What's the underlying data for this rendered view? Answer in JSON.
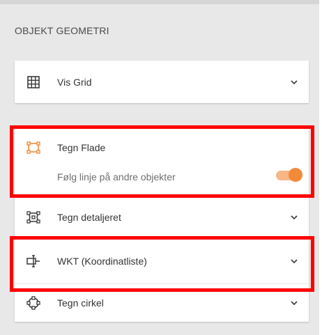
{
  "panel": {
    "section_title": "OBJEKT GEOMETRI"
  },
  "items": {
    "vis_grid": {
      "label": "Vis Grid",
      "icon": "grid-icon"
    },
    "tegn_flade": {
      "label": "Tegn Flade",
      "icon": "polygon-icon",
      "icon_color": "#f28a3a"
    },
    "folg_linje": {
      "label": "Følg linje på andre objekter",
      "toggle_on": true
    },
    "tegn_detaljeret": {
      "label": "Tegn detaljeret",
      "icon": "detailed-polygon-icon"
    },
    "wkt": {
      "label": "WKT (Koordinatliste)",
      "icon": "wkt-icon"
    },
    "tegn_cirkel": {
      "label": "Tegn cirkel",
      "icon": "circle-draw-icon"
    }
  },
  "colors": {
    "accent": "#f28a3a",
    "accent_light": "#f7b685",
    "highlight": "#ff0000",
    "panel_bg": "#e8e8e8"
  }
}
